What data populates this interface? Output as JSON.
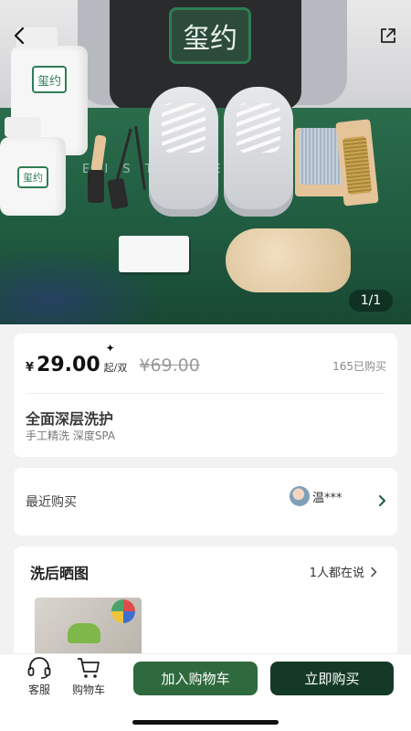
{
  "hero": {
    "logo_text": "玺约",
    "strip_text": "E I S T    S   O E",
    "counter": "1/1",
    "back_icon": "chevron-left-icon",
    "share_icon": "share-icon"
  },
  "price_card": {
    "currency": "¥",
    "price": "29.00",
    "unit": "起/双",
    "sparkle": "✦",
    "original_price": "69.00",
    "original_currency": "¥",
    "sold": "165已购买",
    "title": "全面深层洗护",
    "subtitle": "手工精洗  深度SPA"
  },
  "recent": {
    "label": "最近购买",
    "buyer_name": "温***"
  },
  "reviews": {
    "title": "洗后晒图",
    "count_text": "1人都在说"
  },
  "bottom_bar": {
    "service_label": "客服",
    "cart_label": "购物车",
    "add_to_cart": "加入购物车",
    "buy_now": "立即购买"
  },
  "colors": {
    "brand_green": "#2e6a3d",
    "dark_green": "#143a27"
  }
}
